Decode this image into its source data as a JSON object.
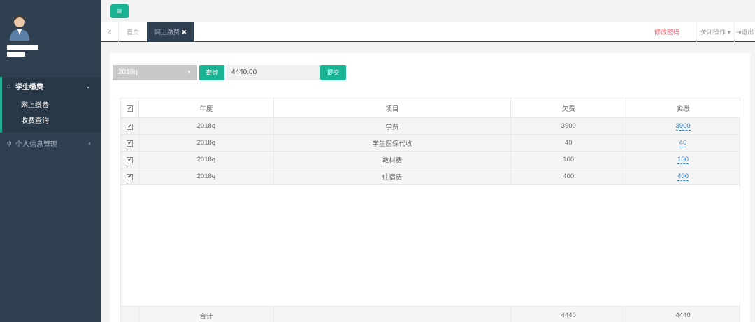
{
  "sidebar": {
    "items": [
      {
        "icon": "home-icon",
        "label": "学生缴费",
        "arrow": "⌄"
      },
      {
        "label": "网上缴费"
      },
      {
        "label": "收费查询"
      },
      {
        "icon": "cutlery-icon",
        "label": "个人信息管理",
        "arrow": "‹"
      }
    ]
  },
  "topbar": {
    "menu_icon": "≡"
  },
  "tabs": {
    "back_icon": "«",
    "home": "首页",
    "active": "网上缴费",
    "change_password": "修改密码",
    "close_ops": "关闭操作",
    "logout": "退出"
  },
  "toolbar": {
    "select_value": "2018q",
    "query_label": "查询",
    "amount_value": "4440.00",
    "submit_label": "提交"
  },
  "table": {
    "headers": [
      "年度",
      "项目",
      "欠费",
      "实缴"
    ],
    "rows": [
      {
        "year": "2018q",
        "item": "学费",
        "owed": "3900",
        "paid": "3900"
      },
      {
        "year": "2018q",
        "item": "学生医保代收",
        "owed": "40",
        "paid": "40"
      },
      {
        "year": "2018q",
        "item": "教材费",
        "owed": "100",
        "paid": "100"
      },
      {
        "year": "2018q",
        "item": "住宿费",
        "owed": "400",
        "paid": "400"
      }
    ],
    "footer": {
      "label": "合计",
      "owed": "4440",
      "paid": "4440"
    }
  },
  "colors": {
    "sidebar": "#2f4050",
    "accent": "#1ab394",
    "danger": "#ed5565"
  }
}
